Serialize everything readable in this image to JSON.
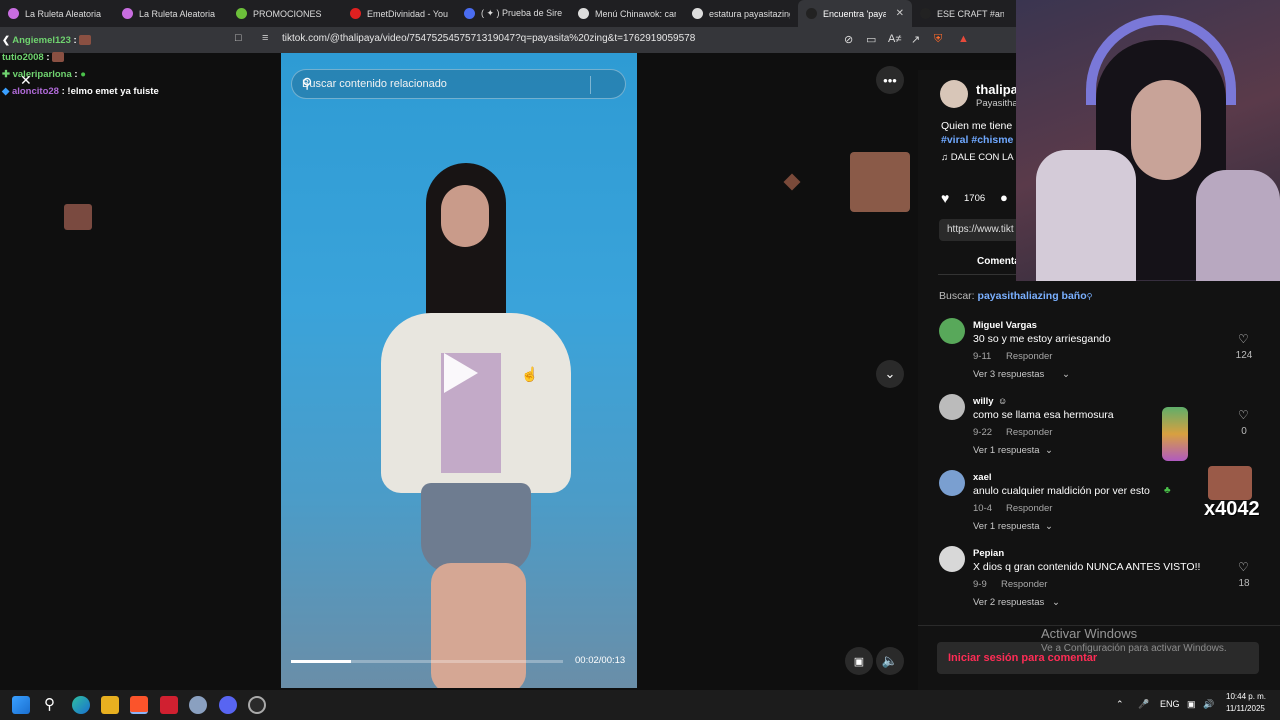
{
  "tabs": [
    {
      "label": "La Ruleta Aleatoria",
      "color": "#c86de0"
    },
    {
      "label": "La Ruleta Aleatoria",
      "color": "#c86de0"
    },
    {
      "label": "PROMOCIONES",
      "color": "#6cbf3a"
    },
    {
      "label": "EmetDivinidad - YouTu",
      "color": "#e02020"
    },
    {
      "label": "( ✦ ) Prueba de Sirena",
      "color": "#4a6cf0"
    },
    {
      "label": "Menú Chinawok: carta",
      "color": "#dddddd"
    },
    {
      "label": "estatura payasitazing",
      "color": "#dddddd"
    },
    {
      "label": "Encuentra 'paya",
      "color": "#222222"
    },
    {
      "label": "ESE CRAFT #anthonyc",
      "color": "#222222"
    }
  ],
  "address": {
    "url": "tiktok.com/@thalipaya/video/7547525457571319047?q=payasita%20zing&t=1762919059578"
  },
  "chat": [
    {
      "user": "Angiemel123",
      "user_color": "#6fd36f",
      "msg": ""
    },
    {
      "user": "tutio2008",
      "user_color": "#6fd36f",
      "msg": ""
    },
    {
      "user": "valeriparlona",
      "user_color": "#6fd36f",
      "msg": ""
    },
    {
      "user": "aloncito28",
      "user_color": "#b06ad8",
      "msg": "!elmo emet ya fuiste"
    }
  ],
  "video": {
    "search_placeholder": "Buscar contenido relacionado",
    "time": "00:02/00:13",
    "progress_fraction": 0.22
  },
  "author": {
    "name": "thalipa",
    "handle": "Payasitha",
    "caption": "Quien me tiene",
    "tags": "#viral #chisme",
    "music": "DALE CON LA",
    "likes": "1706",
    "link": "https://www.tikt",
    "comments_tab": "Comenta"
  },
  "comments_header": {
    "prefix": "Buscar:",
    "query": "payasithaliazing baño"
  },
  "comments": [
    {
      "name": "Miguel Vargas",
      "text": "30 so y me estoy arriesgando",
      "date": "9-11",
      "reply": "Responder",
      "replies": "Ver 3 respuestas",
      "likes": "124",
      "avatar": "#58a85a"
    },
    {
      "name": "willy",
      "text": "como se llama esa hermosura",
      "date": "9-22",
      "reply": "Responder",
      "replies": "Ver 1 respuesta",
      "likes": "0",
      "avatar": "#bbbbbb"
    },
    {
      "name": "xael",
      "text": "anulo cualquier maldición por ver esto",
      "date": "10-4",
      "reply": "Responder",
      "replies": "Ver 1 respuesta",
      "likes": "",
      "avatar": "#7a9fd0"
    },
    {
      "name": "Pepian",
      "text": "X dios q gran contenido NUNCA ANTES VISTO!!",
      "date": "9-9",
      "reply": "Responder",
      "replies": "Ver 2 respuestas",
      "likes": "18",
      "avatar": "#d8d8d8"
    }
  ],
  "overlay_text": "x4042",
  "login": {
    "label": "Iniciar sesión para comentar"
  },
  "windows": {
    "title": "Activar Windows",
    "subtitle": "Ve a Configuración para activar Windows."
  },
  "tray": {
    "lang": "ENG",
    "time": "10:44 p. m.",
    "date": "11/11/2025"
  }
}
